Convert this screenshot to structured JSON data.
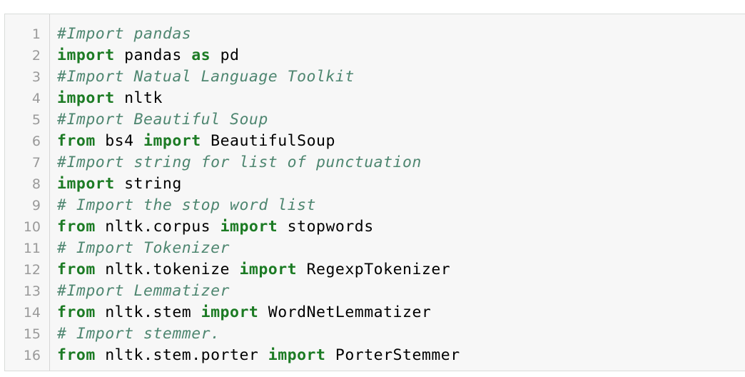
{
  "code_block": {
    "lines": [
      {
        "number": "1",
        "tokens": [
          {
            "type": "comment",
            "text": "#Import pandas"
          }
        ]
      },
      {
        "number": "2",
        "tokens": [
          {
            "type": "kw",
            "text": "import"
          },
          {
            "type": "plain",
            "text": " pandas "
          },
          {
            "type": "kw",
            "text": "as"
          },
          {
            "type": "plain",
            "text": " pd"
          }
        ]
      },
      {
        "number": "3",
        "tokens": [
          {
            "type": "comment",
            "text": "#Import Natual Language Toolkit"
          }
        ]
      },
      {
        "number": "4",
        "tokens": [
          {
            "type": "kw",
            "text": "import"
          },
          {
            "type": "plain",
            "text": " nltk"
          }
        ]
      },
      {
        "number": "5",
        "tokens": [
          {
            "type": "comment",
            "text": "#Import Beautiful Soup"
          }
        ]
      },
      {
        "number": "6",
        "tokens": [
          {
            "type": "kw",
            "text": "from"
          },
          {
            "type": "plain",
            "text": " bs4 "
          },
          {
            "type": "kw",
            "text": "import"
          },
          {
            "type": "plain",
            "text": " BeautifulSoup"
          }
        ]
      },
      {
        "number": "7",
        "tokens": [
          {
            "type": "comment",
            "text": "#Import string for list of punctuation"
          }
        ]
      },
      {
        "number": "8",
        "tokens": [
          {
            "type": "kw",
            "text": "import"
          },
          {
            "type": "plain",
            "text": " string"
          }
        ]
      },
      {
        "number": "9",
        "tokens": [
          {
            "type": "comment",
            "text": "# Import the stop word list"
          }
        ]
      },
      {
        "number": "10",
        "tokens": [
          {
            "type": "kw",
            "text": "from"
          },
          {
            "type": "plain",
            "text": " nltk.corpus "
          },
          {
            "type": "kw",
            "text": "import"
          },
          {
            "type": "plain",
            "text": " stopwords"
          }
        ]
      },
      {
        "number": "11",
        "tokens": [
          {
            "type": "comment",
            "text": "# Import Tokenizer"
          }
        ]
      },
      {
        "number": "12",
        "tokens": [
          {
            "type": "kw",
            "text": "from"
          },
          {
            "type": "plain",
            "text": " nltk.tokenize "
          },
          {
            "type": "kw",
            "text": "import"
          },
          {
            "type": "plain",
            "text": " RegexpTokenizer"
          }
        ]
      },
      {
        "number": "13",
        "tokens": [
          {
            "type": "comment",
            "text": "#Import Lemmatizer"
          }
        ]
      },
      {
        "number": "14",
        "tokens": [
          {
            "type": "kw",
            "text": "from"
          },
          {
            "type": "plain",
            "text": " nltk.stem "
          },
          {
            "type": "kw",
            "text": "import"
          },
          {
            "type": "plain",
            "text": " WordNetLemmatizer"
          }
        ]
      },
      {
        "number": "15",
        "tokens": [
          {
            "type": "comment",
            "text": "# Import stemmer."
          }
        ]
      },
      {
        "number": "16",
        "tokens": [
          {
            "type": "kw",
            "text": "from"
          },
          {
            "type": "plain",
            "text": " nltk.stem.porter "
          },
          {
            "type": "kw",
            "text": "import"
          },
          {
            "type": "plain",
            "text": " PorterStemmer"
          }
        ]
      }
    ]
  },
  "colors": {
    "keyword": "#1c7b24",
    "comment": "#4e8670",
    "plain": "#000000",
    "line_number": "#9a9a9a",
    "background": "#f7f7f7",
    "border": "#d9dcda"
  }
}
